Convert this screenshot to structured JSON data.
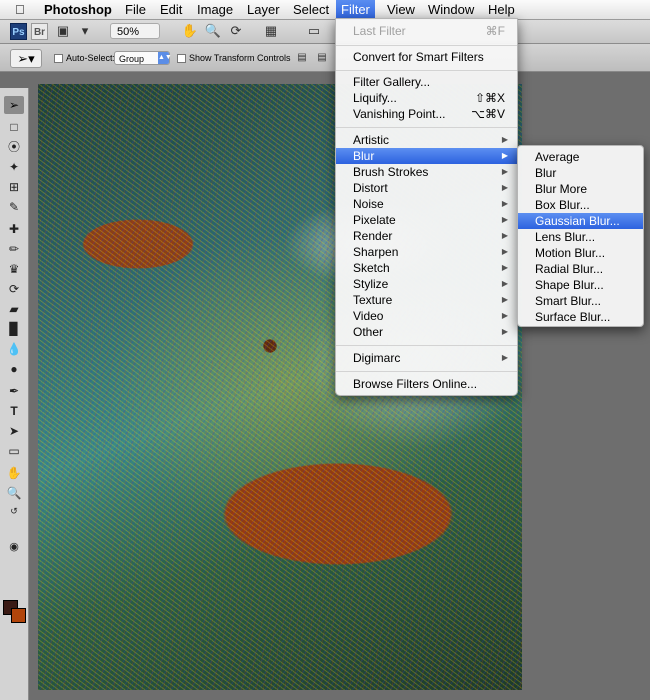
{
  "menubar": {
    "apple": "",
    "app_name": "Photoshop",
    "items": [
      "File",
      "Edit",
      "Image",
      "Layer",
      "Select",
      "Filter",
      "View",
      "Window",
      "Help"
    ]
  },
  "appbar": {
    "ps_logo": "Ps",
    "br_logo": "Br",
    "zoom": "50%"
  },
  "options": {
    "auto_select_label": "Auto-Select:",
    "auto_select_value": "Group",
    "transform_label": "Show Transform Controls"
  },
  "filter_menu": {
    "last_filter": {
      "label": "Last Filter",
      "shortcut": "⌘F"
    },
    "convert": "Convert for Smart Filters",
    "filter_gallery": "Filter Gallery...",
    "liquify": {
      "label": "Liquify...",
      "shortcut": "⇧⌘X"
    },
    "vanishing_point": {
      "label": "Vanishing Point...",
      "shortcut": "⌥⌘V"
    },
    "groups": [
      "Artistic",
      "Blur",
      "Brush Strokes",
      "Distort",
      "Noise",
      "Pixelate",
      "Render",
      "Sharpen",
      "Sketch",
      "Stylize",
      "Texture",
      "Video",
      "Other"
    ],
    "digimarc": "Digimarc",
    "browse_online": "Browse Filters Online...",
    "highlighted": "Blur"
  },
  "blur_submenu": {
    "items": [
      "Average",
      "Blur",
      "Blur More",
      "Box Blur...",
      "Gaussian Blur...",
      "Lens Blur...",
      "Motion Blur...",
      "Radial Blur...",
      "Shape Blur...",
      "Smart Blur...",
      "Surface Blur..."
    ],
    "highlighted": "Gaussian Blur..."
  },
  "colors": {
    "foreground": "#3a1a14",
    "background": "#b2450a",
    "highlight": "#3d72e6"
  }
}
